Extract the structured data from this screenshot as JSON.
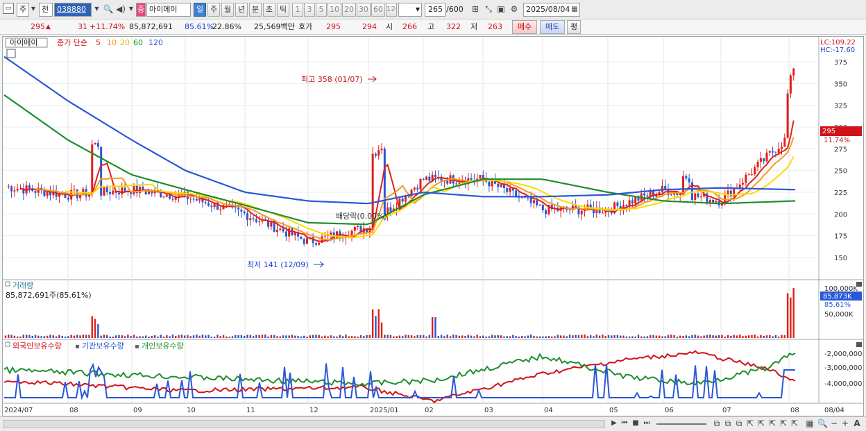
{
  "toolbar": {
    "market_type": "주",
    "range_label": "전",
    "stock_code": "038880",
    "stock_badge": "중",
    "stock_name": "아이에이",
    "periods": [
      "일",
      "주",
      "월",
      "년",
      "분",
      "초",
      "틱"
    ],
    "active_period": "일",
    "intervals": [
      "1",
      "3",
      "5",
      "10",
      "20",
      "30",
      "60",
      "120"
    ],
    "count": "265",
    "count_total": "/600",
    "date": "2025/08/04"
  },
  "quote": {
    "price": "295",
    "change_arrow": "▲",
    "change": "31",
    "change_rate": "+11.74%",
    "volume": "85,872,691",
    "volume_rate": "85.61%",
    "turnover": "22.86%",
    "amount": "25,569백만",
    "bid_label": "호가",
    "ask_price": "295",
    "bid_price": "294",
    "open_label": "시",
    "open": "266",
    "high_label": "고",
    "high": "322",
    "low_label": "저",
    "low": "263",
    "buy_button": "매수",
    "sell_button": "매도",
    "eval_button": "평"
  },
  "price_panel": {
    "title": "아이에이",
    "ma_label": "종가 단순",
    "ma_periods": [
      "5",
      "10",
      "20",
      "60",
      "120"
    ],
    "ma_colors": [
      "#e0201a",
      "#f59a23",
      "#ffd800",
      "#1f8e2e",
      "#2a57d6"
    ],
    "lc": "LC:109.22",
    "hc": "HC:-17.60",
    "y_ticks": [
      "375",
      "350",
      "325",
      "300",
      "275",
      "250",
      "225",
      "200",
      "175",
      "150"
    ],
    "current_price": "295",
    "current_rate": "11.74%",
    "high_annotation": "최고 358 (01/07)",
    "low_annotation": "최저 141 (12/09)",
    "dividend_annotation": "배당락(0.00%)"
  },
  "volume_panel": {
    "title": "거래량",
    "value_label": "85,872,691주(85.61%)",
    "y_ticks": [
      "100,000K",
      "50,000K"
    ],
    "current_value": "85,873K",
    "current_rate": "85.61%"
  },
  "holdings_panel": {
    "legends": [
      "외국인보유수량",
      "기관보유수량",
      "개인보유수량"
    ],
    "legend_colors": [
      "#d0121b",
      "#2a57d6",
      "#1f8e2e"
    ],
    "y_ticks": [
      "-2,000,000",
      "-3,000,000",
      "-4,000,000"
    ]
  },
  "x_axis": {
    "labels": [
      "2024/07",
      "08",
      "09",
      "10",
      "11",
      "12",
      "2025/01",
      "02",
      "03",
      "04",
      "05",
      "06",
      "07",
      "08"
    ],
    "end_label": "08/04"
  },
  "chart_data": {
    "type": "line",
    "x": [
      "2024/07",
      "2024/08",
      "2024/09",
      "2024/10",
      "2024/11",
      "2024/12",
      "2025/01",
      "2025/02",
      "2025/03",
      "2025/04",
      "2025/05",
      "2025/06",
      "2025/07",
      "2025/08"
    ],
    "series": [
      {
        "name": "종가",
        "values": [
          232,
          222,
          228,
          220,
          200,
          168,
          185,
          240,
          240,
          205,
          205,
          228,
          215,
          295
        ]
      },
      {
        "name": "120",
        "values": [
          382,
          330,
          285,
          250,
          225,
          215,
          212,
          225,
          220,
          220,
          222,
          228,
          230,
          228
        ]
      },
      {
        "name": "60",
        "values": [
          338,
          285,
          245,
          228,
          210,
          190,
          188,
          222,
          240,
          240,
          225,
          215,
          212,
          215
        ]
      }
    ],
    "ylim": [
      141,
      380
    ],
    "high": 358,
    "low": 141
  }
}
